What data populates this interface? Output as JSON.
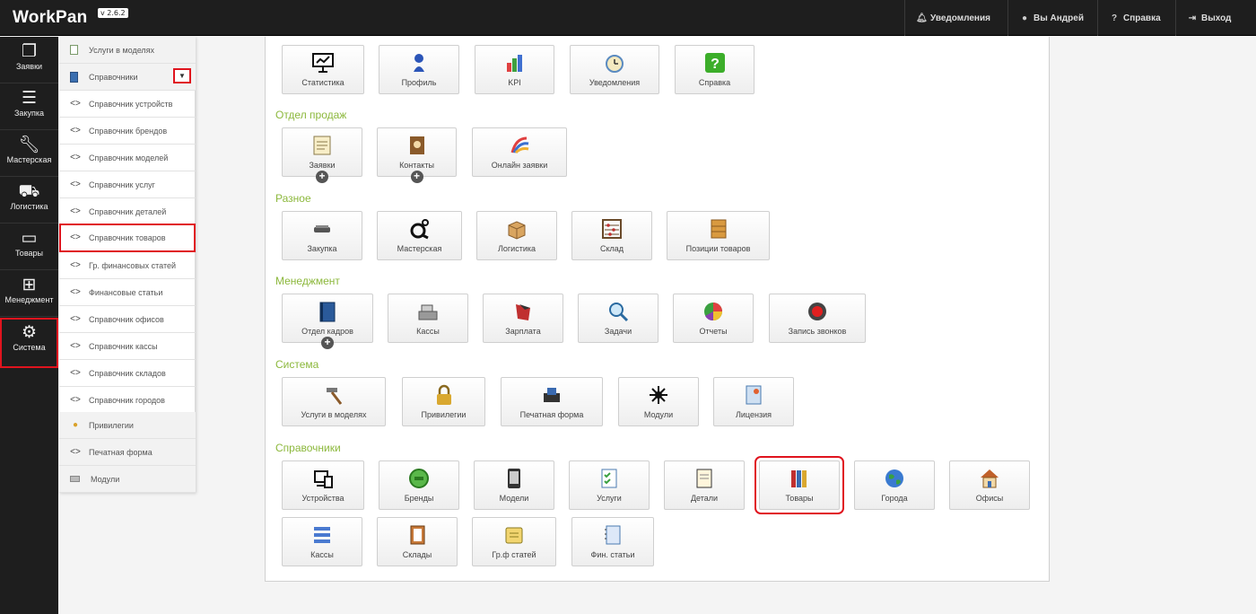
{
  "app": {
    "title": "WorkPan",
    "version": "v 2.6.2"
  },
  "topbar": {
    "notifications": "Уведомления",
    "user": "Вы Андрей",
    "help": "Справка",
    "logout": "Выход"
  },
  "rail": [
    {
      "label": "Заявки",
      "icon": "documents-icon"
    },
    {
      "label": "Закупка",
      "icon": "menu-icon"
    },
    {
      "label": "Мастерская",
      "icon": "wrench-icon"
    },
    {
      "label": "Логистика",
      "icon": "truck-icon"
    },
    {
      "label": "Товары",
      "icon": "drive-icon"
    },
    {
      "label": "Менеджмент",
      "icon": "sitemap-icon"
    },
    {
      "label": "Система",
      "icon": "gears-icon"
    }
  ],
  "subnav": [
    {
      "label": "Услуги в моделях",
      "icon": "note-icon"
    },
    {
      "label": "Справочники",
      "icon": "book-icon"
    },
    {
      "label": "Справочник устройств",
      "icon": "code-icon"
    },
    {
      "label": "Справочник брендов",
      "icon": "code-icon"
    },
    {
      "label": "Справочник моделей",
      "icon": "code-icon"
    },
    {
      "label": "Справочник услуг",
      "icon": "code-icon"
    },
    {
      "label": "Справочник деталей",
      "icon": "code-icon"
    },
    {
      "label": "Справочник товаров",
      "icon": "code-icon"
    },
    {
      "label": "Гр. финансовых статей",
      "icon": "code-icon"
    },
    {
      "label": "Финансовые статьи",
      "icon": "code-icon"
    },
    {
      "label": "Справочник офисов",
      "icon": "code-icon"
    },
    {
      "label": "Справочник кассы",
      "icon": "code-icon"
    },
    {
      "label": "Справочник складов",
      "icon": "code-icon"
    },
    {
      "label": "Справочник городов",
      "icon": "code-icon"
    },
    {
      "label": "Привилегии",
      "icon": "bulb-icon"
    },
    {
      "label": "Печатная форма",
      "icon": "code-icon"
    },
    {
      "label": "Модули",
      "icon": "keyboard-icon"
    }
  ],
  "main": {
    "top_tiles": [
      "Статистика",
      "Профиль",
      "KPI",
      "Уведомления",
      "Справка"
    ],
    "sections": {
      "sales": {
        "title": "Отдел продаж",
        "tiles": [
          "Заявки",
          "Контакты",
          "Онлайн заявки"
        ]
      },
      "misc": {
        "title": "Разное",
        "tiles": [
          "Закупка",
          "Мастерская",
          "Логистика",
          "Склад",
          "Позиции товаров"
        ]
      },
      "management": {
        "title": "Менеджмент",
        "tiles": [
          "Отдел кадров",
          "Кассы",
          "Зарплата",
          "Задачи",
          "Отчеты",
          "Запись звонков"
        ]
      },
      "system": {
        "title": "Система",
        "tiles": [
          "Услуги в моделях",
          "Привилегии",
          "Печатная форма",
          "Модули",
          "Лицензия"
        ]
      },
      "references": {
        "title": "Справочники",
        "tiles": [
          "Устройства",
          "Бренды",
          "Модели",
          "Услуги",
          "Детали",
          "Товары",
          "Города",
          "Офисы",
          "Кассы",
          "Склады",
          "Гр.ф статей",
          "Фин. статьи"
        ]
      }
    }
  },
  "colors": {
    "highlight": "#e0141e",
    "section_title": "#8cb83c",
    "topbar": "#1e1e1e"
  }
}
